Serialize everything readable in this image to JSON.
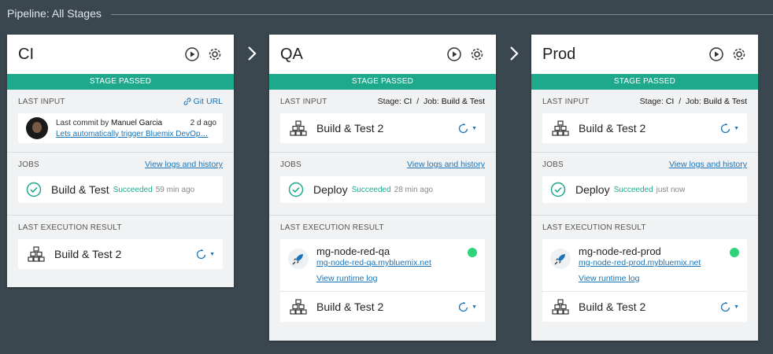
{
  "pipeline": {
    "title": "Pipeline: All Stages"
  },
  "colors": {
    "accent": "#1ea88c",
    "link": "#1b74b5",
    "running": "#2ed47a",
    "background": "#3a474f"
  },
  "icons": {
    "run": "play-circle-icon",
    "settings": "gear-icon",
    "next": "chevron-right-icon",
    "build": "build-stack-icon",
    "deploy_history": "redeploy-icon",
    "success": "check-circle-icon",
    "app": "rocket-icon",
    "link": "link-icon"
  },
  "stages": {
    "ci": {
      "name": "CI",
      "status": "STAGE PASSED",
      "last_input": {
        "label": "LAST INPUT",
        "link": "Git URL",
        "commit_prefix": "Last commit by",
        "author": "Manuel Garcia",
        "time": "2 d ago",
        "message": "Lets automatically trigger Bluemix DevOp…"
      },
      "jobs": {
        "label": "JOBS",
        "link": "View logs and history",
        "job": {
          "name": "Build & Test",
          "status": "Succeeded",
          "time": "59 min ago"
        }
      },
      "result": {
        "label": "LAST EXECUTION RESULT",
        "build": "Build & Test 2"
      }
    },
    "qa": {
      "name": "QA",
      "status": "STAGE PASSED",
      "last_input": {
        "label": "LAST INPUT",
        "stage_label": "Stage:",
        "stage": "CI",
        "sep": "/",
        "job_label": "Job:",
        "job": "Build & Test",
        "build": "Build & Test 2"
      },
      "jobs": {
        "label": "JOBS",
        "link": "View logs and history",
        "job": {
          "name": "Deploy",
          "status": "Succeeded",
          "time": "28 min ago"
        }
      },
      "result": {
        "label": "LAST EXECUTION RESULT",
        "app_name": "mg-node-red-qa",
        "app_url": "mg-node-red-qa.mybluemix.net",
        "log_link": "View runtime log",
        "build": "Build & Test 2"
      }
    },
    "prod": {
      "name": "Prod",
      "status": "STAGE PASSED",
      "last_input": {
        "label": "LAST INPUT",
        "stage_label": "Stage:",
        "stage": "CI",
        "sep": "/",
        "job_label": "Job:",
        "job": "Build & Test",
        "build": "Build & Test 2"
      },
      "jobs": {
        "label": "JOBS",
        "link": "View logs and history",
        "job": {
          "name": "Deploy",
          "status": "Succeeded",
          "time": "just now"
        }
      },
      "result": {
        "label": "LAST EXECUTION RESULT",
        "app_name": "mg-node-red-prod",
        "app_url": "mg-node-red-prod.mybluemix.net",
        "log_link": "View runtime log",
        "build": "Build & Test 2"
      }
    }
  }
}
